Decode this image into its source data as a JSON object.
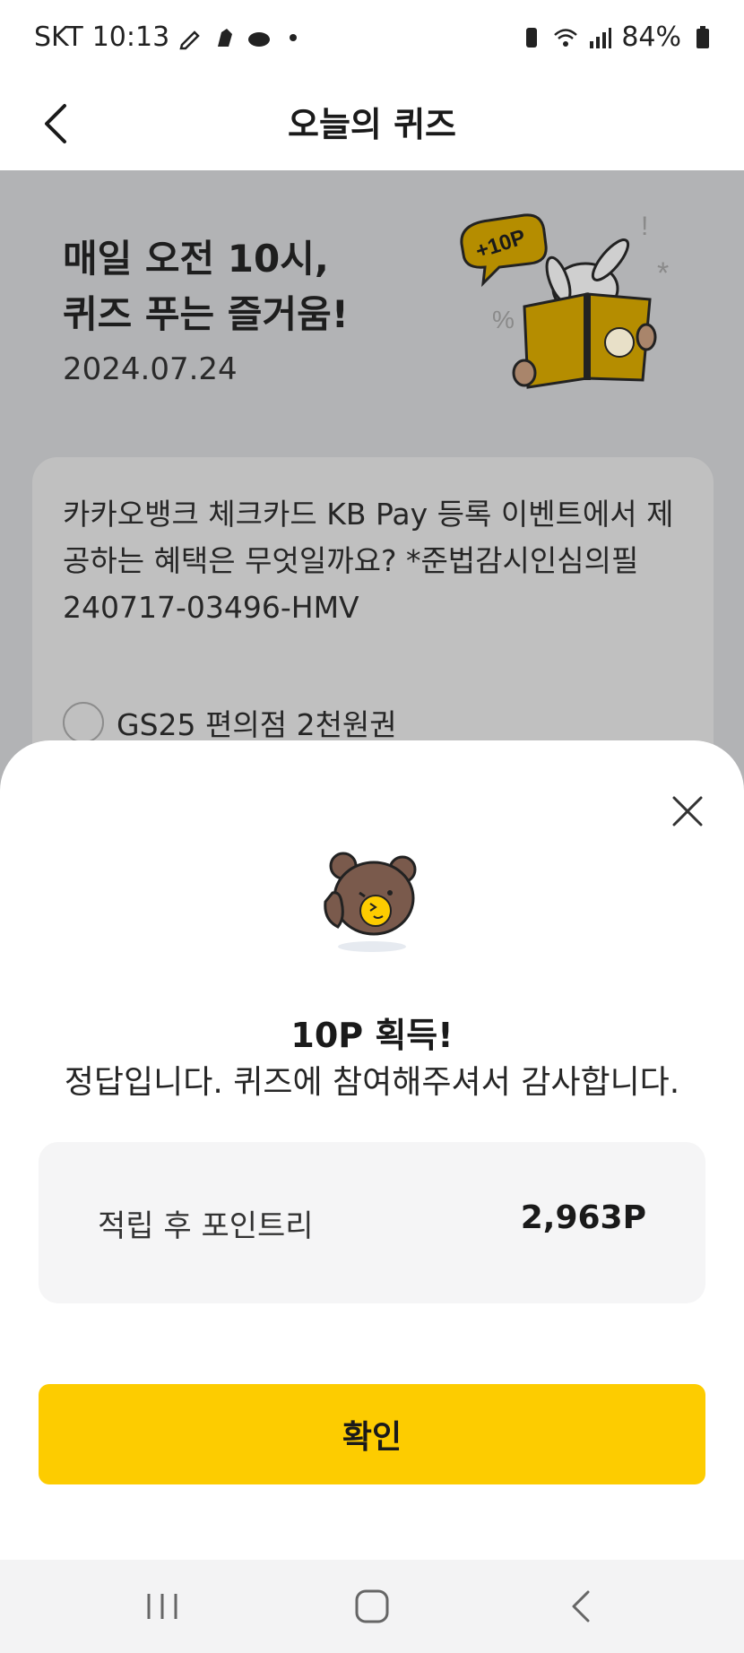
{
  "status_bar": {
    "carrier": "SKT",
    "time": "10:13",
    "battery": "84%",
    "icons": [
      "pencil-icon",
      "shoe-icon",
      "cloud-icon",
      "dot-icon",
      "battery-saver-icon",
      "wifi-icon",
      "signal-icon",
      "battery-icon"
    ]
  },
  "header": {
    "title": "오늘의 퀴즈",
    "back_icon": "back-arrow-icon"
  },
  "hero": {
    "title_line1": "매일 오전 10시,",
    "title_line2": "퀴즈 푸는 즐거움!",
    "date": "2024.07.24",
    "badge": "+10P"
  },
  "quiz": {
    "question": "카카오뱅크 체크카드 KB Pay 등록 이벤트에서 제공하는 혜택은 무엇일까요? *준법감시인심의필 240717-03496-HMV",
    "options": [
      "GS25 편의점 2천원권"
    ]
  },
  "result_sheet": {
    "title": "10P 획득!",
    "message": "정답입니다. 퀴즈에 참여해주셔서 감사합니다.",
    "points_label": "적립 후 포인트리",
    "points_value": "2,963P",
    "confirm_label": "확인",
    "close_icon": "close-icon"
  },
  "colors": {
    "accent": "#fdcc00",
    "dim_overlay": "#b2b3b5",
    "points_box": "#f5f5f6"
  }
}
